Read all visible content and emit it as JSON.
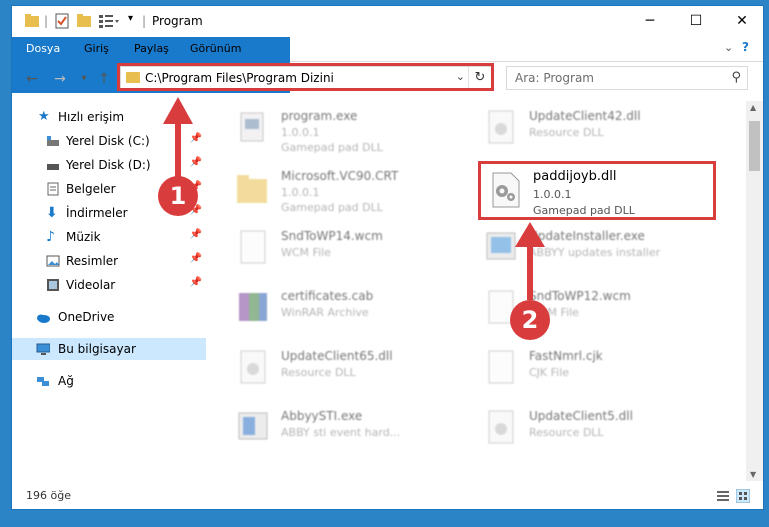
{
  "window": {
    "title": "Program",
    "controls": {
      "minimize": "─",
      "maximize": "☐",
      "close": "✕"
    }
  },
  "ribbon": {
    "tabs": [
      "Dosya",
      "Giriş",
      "Paylaş",
      "Görünüm"
    ]
  },
  "address": {
    "path": "C:\\Program Files\\Program Dizini",
    "search_placeholder": "Ara: Program"
  },
  "sidebar": {
    "items": [
      {
        "label": "Hızlı erişim",
        "icon": "star-icon"
      },
      {
        "label": "Yerel Disk (C:)",
        "icon": "drive-icon",
        "pinned": true
      },
      {
        "label": "Yerel Disk (D:)",
        "icon": "drive-icon",
        "pinned": true
      },
      {
        "label": "Belgeler",
        "icon": "documents-icon",
        "pinned": true
      },
      {
        "label": "İndirmeler",
        "icon": "download-icon",
        "pinned": true
      },
      {
        "label": "Müzik",
        "icon": "music-icon",
        "pinned": true
      },
      {
        "label": "Resimler",
        "icon": "pictures-icon",
        "pinned": true
      },
      {
        "label": "Videolar",
        "icon": "videos-icon",
        "pinned": true
      },
      {
        "label": "OneDrive",
        "icon": "cloud-icon"
      },
      {
        "label": "Bu bilgisayar",
        "icon": "computer-icon",
        "selected": true
      },
      {
        "label": "Ağ",
        "icon": "network-icon"
      }
    ]
  },
  "files": [
    {
      "name": "program.exe",
      "l1": "1.0.0.1",
      "l2": "Gamepad pad DLL",
      "icon": "exe-icon"
    },
    {
      "name": "UpdateClient42.dll",
      "l1": "Resource DLL",
      "l2": "",
      "icon": "dll-icon"
    },
    {
      "name": "Microsoft.VC90.CRT",
      "l1": "1.0.0.1",
      "l2": "Gamepad pad DLL",
      "icon": "folder-icon"
    },
    {
      "name": "paddijoyb.dll",
      "l1": "1.0.0.1",
      "l2": "Gamepad pad DLL",
      "icon": "dll-gear-icon"
    },
    {
      "name": "SndToWP14.wcm",
      "l1": "WCM File",
      "l2": "",
      "icon": "file-icon"
    },
    {
      "name": "UpdateInstaller.exe",
      "l1": "ABBYY updates installer",
      "l2": "",
      "icon": "installer-icon"
    },
    {
      "name": "certificates.cab",
      "l1": "WinRAR Archive",
      "l2": "",
      "icon": "archive-icon"
    },
    {
      "name": "SndToWP12.wcm",
      "l1": "WCM File",
      "l2": "",
      "icon": "file-icon"
    },
    {
      "name": "UpdateClient65.dll",
      "l1": "Resource DLL",
      "l2": "",
      "icon": "dll-icon"
    },
    {
      "name": "FastNmrl.cjk",
      "l1": "CJK File",
      "l2": "",
      "icon": "file-icon"
    },
    {
      "name": "AbbyySTI.exe",
      "l1": "ABBY sti event hard...",
      "l2": "",
      "icon": "app-icon"
    },
    {
      "name": "UpdateClient5.dll",
      "l1": "Resource DLL",
      "l2": "",
      "icon": "dll-icon"
    }
  ],
  "status": {
    "count": "196 öğe"
  },
  "annotations": {
    "step1": "1",
    "step2": "2",
    "color": "#d93c3c"
  }
}
